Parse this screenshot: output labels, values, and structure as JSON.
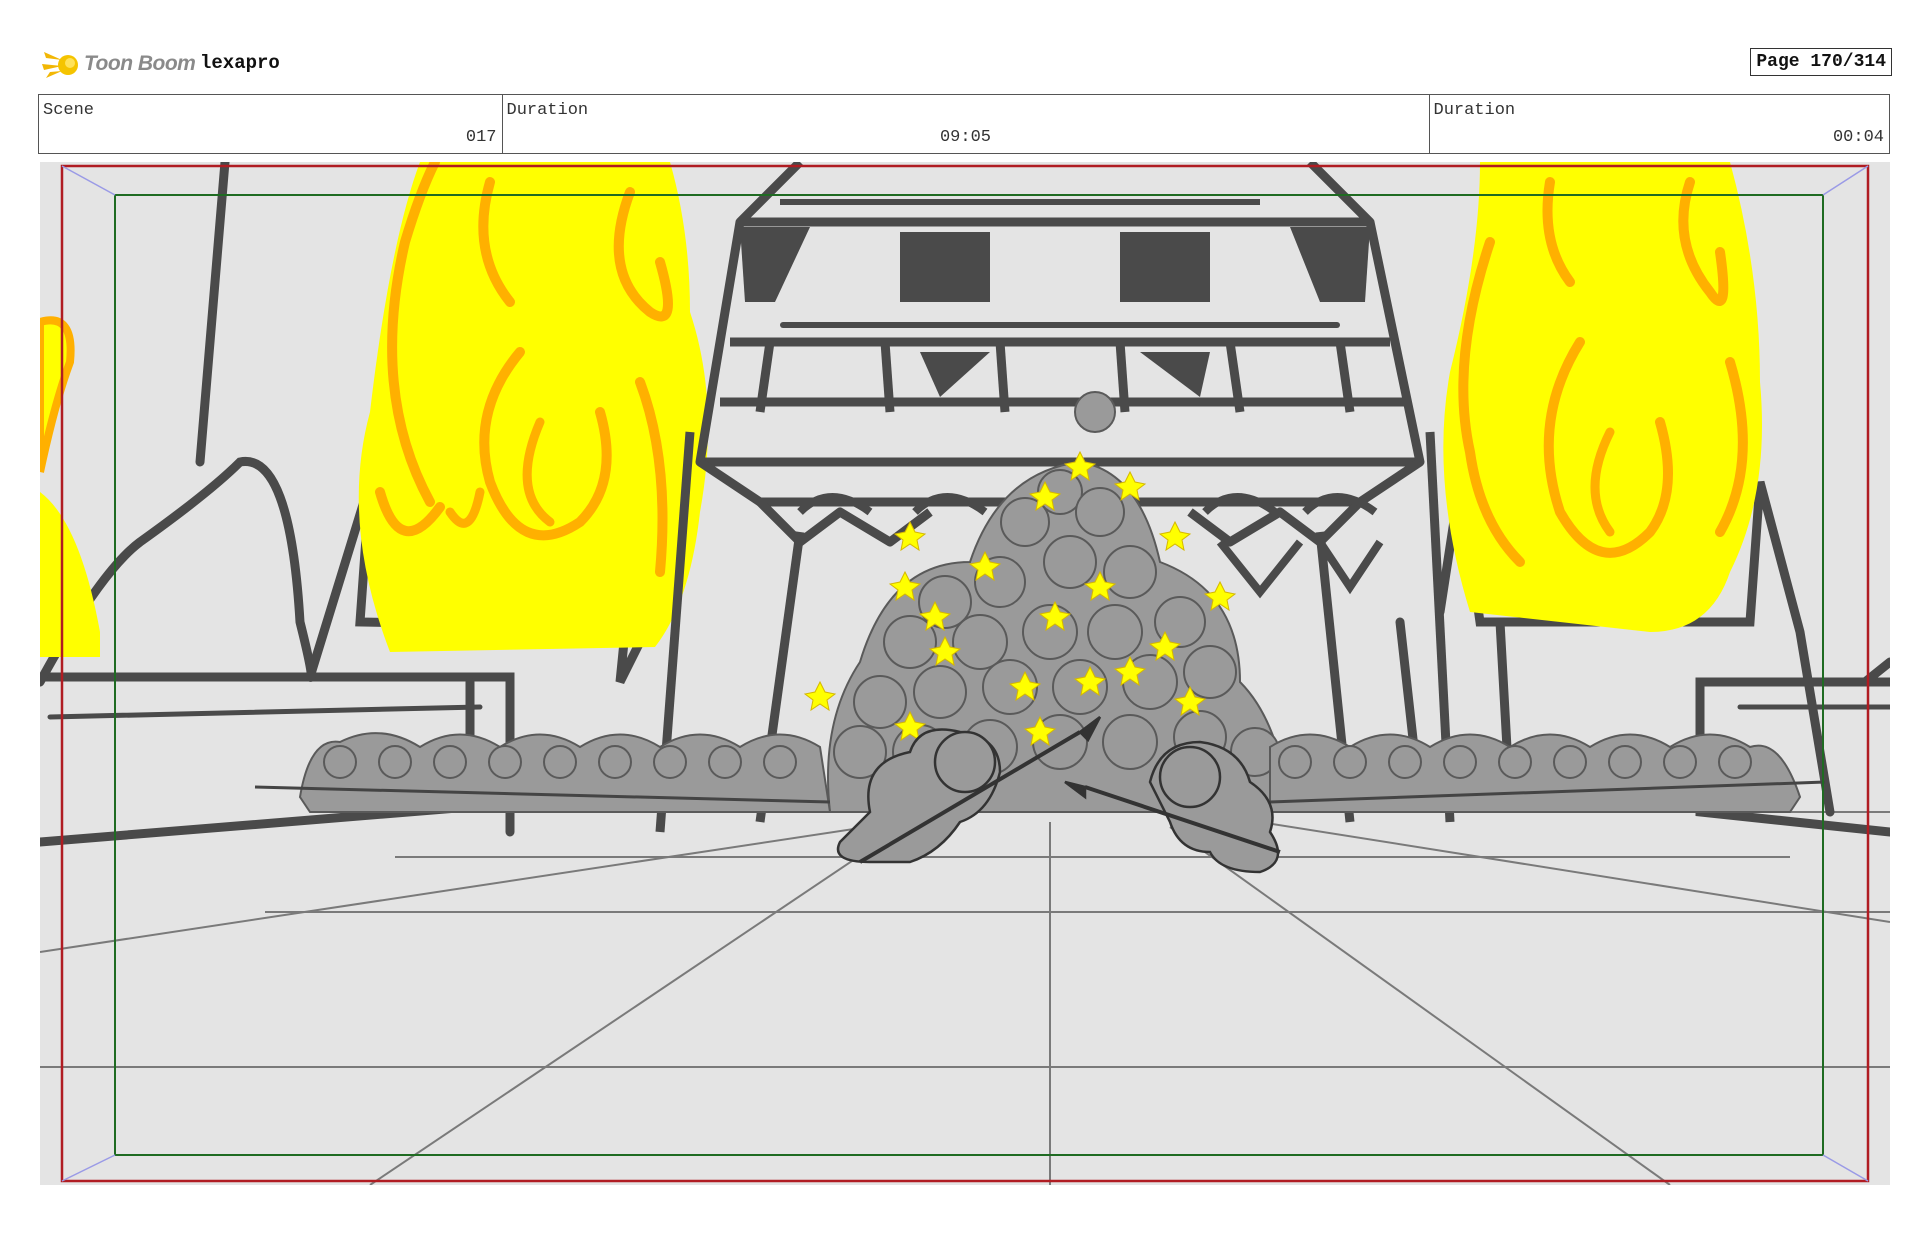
{
  "header": {
    "logo_text": "Toon Boom",
    "project": "lexapro",
    "page": "Page 170/314"
  },
  "info": {
    "scene_label": "Scene",
    "scene_value": "017",
    "duration1_label": "Duration",
    "duration1_value": "09:05",
    "duration2_label": "Duration",
    "duration2_value": "00:04"
  },
  "colors": {
    "flame_yellow": "#ffff00",
    "flame_orange": "#ffb000",
    "line_dark": "#4a4a4a",
    "safe_frame_red": "#b01c22",
    "title_safe_green": "#1f6b22"
  }
}
